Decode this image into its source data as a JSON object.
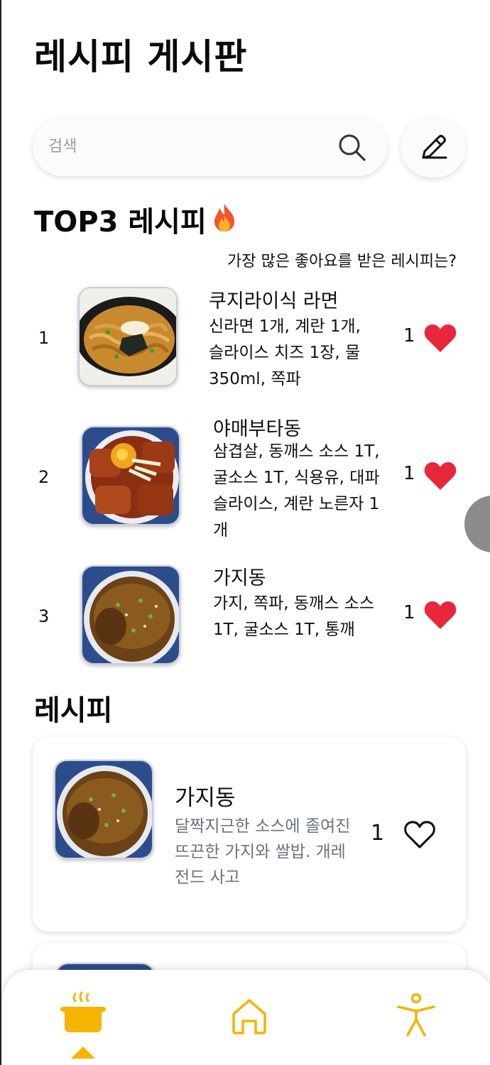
{
  "header": {
    "title": "레시피 게시판"
  },
  "search": {
    "placeholder": "검색",
    "value": ""
  },
  "top3": {
    "title": "TOP3 레시피",
    "subtitle": "가장 많은 좋아요를 받은 레시피는?",
    "items": [
      {
        "rank": "1",
        "name": "쿠지라이식 라면",
        "ingredients": "신라면 1개, 계란 1개, 슬라이스 치즈 1장, 물 350ml, 쪽파",
        "likes": "1",
        "image": "ramen-photo"
      },
      {
        "rank": "2",
        "name": "야매부타동",
        "ingredients": "삼겹살, 동깨스 소스 1T, 굴소스 1T, 식용유, 대파 슬라이스, 계란 노른자 1개",
        "likes": "1",
        "image": "butadon-photo"
      },
      {
        "rank": "3",
        "name": "가지동",
        "ingredients": "가지, 쪽파, 동깨스 소스 1T, 굴소스 1T, 통깨",
        "likes": "1",
        "image": "eggplant-don-photo"
      }
    ]
  },
  "recipes": {
    "title": "레시피",
    "items": [
      {
        "name": "가지동",
        "description": "달짝지근한 소스에 졸여진 뜨끈한 가지와 쌀밥. 개레전드 사고",
        "likes": "1",
        "liked": false
      }
    ]
  },
  "nav": {
    "items": [
      {
        "icon": "cooking-pot-icon",
        "active": true
      },
      {
        "icon": "home-icon",
        "active": false
      },
      {
        "icon": "accessibility-icon",
        "active": false
      }
    ]
  },
  "colors": {
    "accent": "#f5b400",
    "heart": "#e8273a",
    "muted": "#6b7280"
  }
}
